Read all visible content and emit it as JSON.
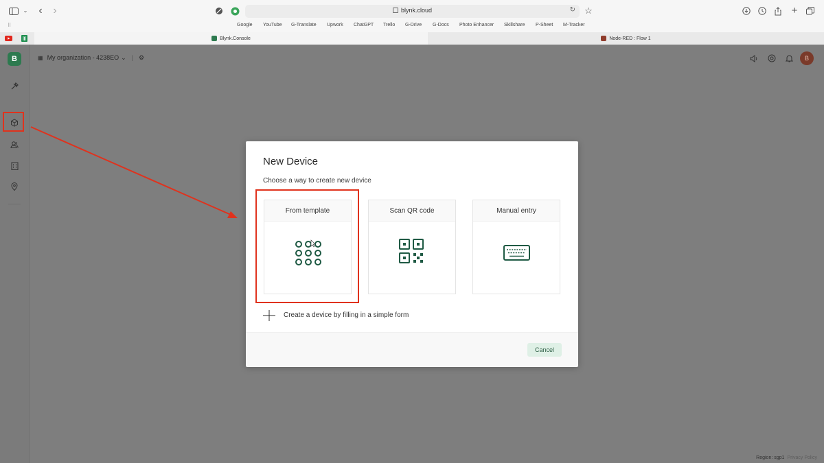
{
  "browser": {
    "url": "blynk.cloud",
    "bookmarks": [
      "Google",
      "YouTube",
      "G-Translate",
      "Upwork",
      "ChatGPT",
      "Trello",
      "G-Drive",
      "G-Docs",
      "Photo Enhancer",
      "Skillshare",
      "P-Sheet",
      "M-Tracker"
    ],
    "tabs": [
      {
        "title": "Blynk.Console",
        "active": true,
        "favicon_color": "#2d7a4f"
      },
      {
        "title": "Node-RED : Flow 1",
        "active": false,
        "favicon_color": "#8f3b2b"
      }
    ]
  },
  "app": {
    "logo_letter": "B",
    "org_name": "My organization - 4238EO",
    "avatar_letter": "B",
    "sidebar_icons": [
      "tools-icon",
      "device-cube-icon",
      "users-icon",
      "organization-icon",
      "location-pin-icon"
    ],
    "footer": {
      "region": "Region: sgp1",
      "privacy": "Privacy Policy"
    }
  },
  "modal": {
    "title": "New Device",
    "subtitle": "Choose a way to create new device",
    "options": [
      {
        "label": "From template",
        "icon": "template-grid-icon"
      },
      {
        "label": "Scan QR code",
        "icon": "qr-code-icon"
      },
      {
        "label": "Manual entry",
        "icon": "keyboard-icon"
      }
    ],
    "simple_form": "Create a device by filling in a simple form",
    "cancel_label": "Cancel"
  },
  "colors": {
    "accent": "#2d7a4f",
    "icon_green": "#1f5a44",
    "highlight": "#e0321d"
  }
}
